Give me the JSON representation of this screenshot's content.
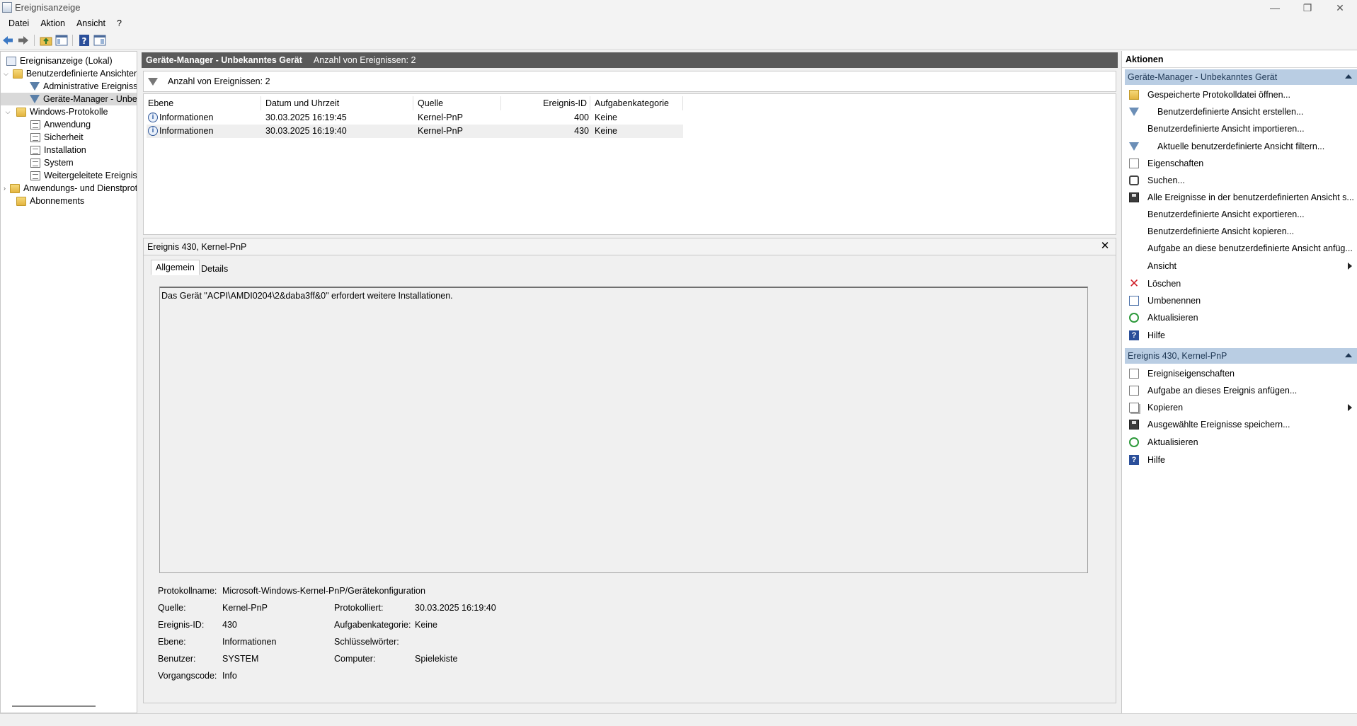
{
  "window": {
    "title": "Ereignisanzeige",
    "controls": {
      "minimize": "—",
      "restore": "❐",
      "close": "✕"
    }
  },
  "menu": [
    "Datei",
    "Aktion",
    "Ansicht",
    "?"
  ],
  "toolbar": {
    "icons": [
      "back-arrow-icon",
      "forward-arrow-icon",
      "folder-up-icon",
      "show-hide-console-tree-icon",
      "help-icon",
      "show-hide-action-pane-icon"
    ]
  },
  "tree": [
    {
      "label": "Ereignisanzeige (Lokal)",
      "level": 0,
      "icon": "event-viewer-icon"
    },
    {
      "label": "Benutzerdefinierte Ansichten",
      "level": 0,
      "expanded": true,
      "icon": "folder-icon"
    },
    {
      "label": "Administrative Ereignisse",
      "level": 1,
      "icon": "filter-icon"
    },
    {
      "label": "Geräte-Manager - Unbekanntes Gerät",
      "level": 1,
      "icon": "filter-icon",
      "selected": true
    },
    {
      "label": "Windows-Protokolle",
      "level": 0,
      "expanded": true,
      "icon": "folder-icon"
    },
    {
      "label": "Anwendung",
      "level": 1,
      "icon": "log-icon"
    },
    {
      "label": "Sicherheit",
      "level": 1,
      "icon": "log-icon"
    },
    {
      "label": "Installation",
      "level": 1,
      "icon": "log-icon"
    },
    {
      "label": "System",
      "level": 1,
      "icon": "log-icon"
    },
    {
      "label": "Weitergeleitete Ereignisse",
      "level": 1,
      "icon": "log-icon"
    },
    {
      "label": "Anwendungs- und Dienstprotokolle",
      "level": 0,
      "expanded": false,
      "icon": "folder-icon"
    },
    {
      "label": "Abonnements",
      "level": 0,
      "icon": "subscriptions-icon"
    }
  ],
  "center": {
    "title": "Geräte-Manager - Unbekanntes Gerät",
    "count_label": "Anzahl von Ereignissen: 2",
    "filter_text": "Anzahl von Ereignissen: 2",
    "columns": [
      "Ebene",
      "Datum und Uhrzeit",
      "Quelle",
      "Ereignis-ID",
      "Aufgabenkategorie"
    ],
    "rows": [
      {
        "level": "Informationen",
        "datetime": "30.03.2025 16:19:45",
        "source": "Kernel-PnP",
        "id": "400",
        "category": "Keine"
      },
      {
        "level": "Informationen",
        "datetime": "30.03.2025 16:19:40",
        "source": "Kernel-PnP",
        "id": "430",
        "category": "Keine"
      }
    ]
  },
  "detail": {
    "title": "Ereignis 430, Kernel-PnP",
    "close": "✕",
    "tabs": [
      "Allgemein",
      "Details"
    ],
    "message": "Das Gerät \"ACPI\\AMDI0204\\2&daba3ff&0\" erfordert weitere Installationen.",
    "fields": {
      "log_name_label": "Protokollname:",
      "log_name": "Microsoft-Windows-Kernel-PnP/Gerätekonfiguration",
      "source_label": "Quelle:",
      "source": "Kernel-PnP",
      "logged_label": "Protokolliert:",
      "logged": "30.03.2025 16:19:40",
      "event_id_label": "Ereignis-ID:",
      "event_id": "430",
      "task_category_label": "Aufgabenkategorie:",
      "task_category": "Keine",
      "level_label": "Ebene:",
      "level": "Informationen",
      "keywords_label": "Schlüsselwörter:",
      "keywords": "",
      "user_label": "Benutzer:",
      "user": "SYSTEM",
      "computer_label": "Computer:",
      "computer": "Spielekiste",
      "opcode_label": "Vorgangscode:",
      "opcode": "Info"
    }
  },
  "actions": {
    "title": "Aktionen",
    "section1": {
      "title": "Geräte-Manager - Unbekanntes Gerät",
      "items": [
        {
          "label": "Gespeicherte Protokolldatei öffnen...",
          "icon": "open-log-icon"
        },
        {
          "label": "Benutzerdefinierte Ansicht erstellen...",
          "icon": "create-view-icon"
        },
        {
          "label": "Benutzerdefinierte Ansicht importieren...",
          "icon": ""
        },
        {
          "label": "Aktuelle benutzerdefinierte Ansicht filtern...",
          "icon": "filter-icon"
        },
        {
          "label": "Eigenschaften",
          "icon": "properties-icon"
        },
        {
          "label": "Suchen...",
          "icon": "find-icon"
        },
        {
          "label": "Alle Ereignisse in der benutzerdefinierten Ansicht s...",
          "icon": "save-icon"
        },
        {
          "label": "Benutzerdefinierte Ansicht exportieren...",
          "icon": ""
        },
        {
          "label": "Benutzerdefinierte Ansicht kopieren...",
          "icon": ""
        },
        {
          "label": "Aufgabe an diese benutzerdefinierte Ansicht anfüg...",
          "icon": ""
        },
        {
          "label": "Ansicht",
          "icon": "",
          "submenu": true
        },
        {
          "label": "Löschen",
          "icon": "delete-icon"
        },
        {
          "label": "Umbenennen",
          "icon": "rename-icon"
        },
        {
          "label": "Aktualisieren",
          "icon": "refresh-icon"
        },
        {
          "label": "Hilfe",
          "icon": "help-icon"
        }
      ]
    },
    "section2": {
      "title": "Ereignis 430, Kernel-PnP",
      "items": [
        {
          "label": "Ereigniseigenschaften",
          "icon": "event-properties-icon"
        },
        {
          "label": "Aufgabe an dieses Ereignis anfügen...",
          "icon": "attach-task-icon"
        },
        {
          "label": "Kopieren",
          "icon": "copy-icon",
          "submenu": true
        },
        {
          "label": "Ausgewählte Ereignisse speichern...",
          "icon": "save-icon"
        },
        {
          "label": "Aktualisieren",
          "icon": "refresh-icon"
        },
        {
          "label": "Hilfe",
          "icon": "help-icon"
        }
      ]
    }
  }
}
